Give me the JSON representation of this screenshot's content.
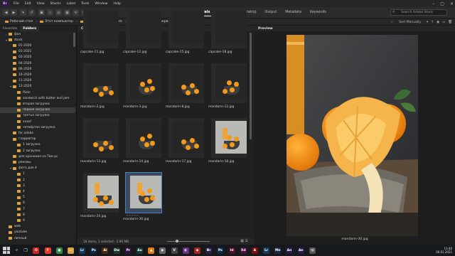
{
  "menubar": {
    "logo": "Br",
    "items": [
      "File",
      "Edit",
      "View",
      "Stacks",
      "Label",
      "Tools",
      "Window",
      "Help"
    ]
  },
  "workspaces": [
    "Essentials",
    "Libraries",
    "Filmstrip",
    "Output",
    "Metadata",
    "Keywords"
  ],
  "search": {
    "placeholder": "Search Adobe Stock"
  },
  "breadcrumb": [
    "Рабочий стол",
    "Этот компьютер",
    "архив (F:)",
    "stock",
    "12-2020",
    "первая загрузка"
  ],
  "sort": {
    "label": "Sort Manually"
  },
  "left_panel": {
    "tabs": [
      "Favorites",
      "Folders"
    ],
    "tree": [
      {
        "label": "фон",
        "depth": 1,
        "expanded": false
      },
      {
        "label": "stock",
        "depth": 1,
        "expanded": true
      },
      {
        "label": "01-2020",
        "depth": 2
      },
      {
        "label": "01-2021",
        "depth": 2
      },
      {
        "label": "02-2020",
        "depth": 2
      },
      {
        "label": "04-2020",
        "depth": 2
      },
      {
        "label": "06-2020",
        "depth": 2
      },
      {
        "label": "10-2020",
        "depth": 2
      },
      {
        "label": "11-2020",
        "depth": 2
      },
      {
        "label": "12-2020",
        "depth": 2,
        "expanded": true
      },
      {
        "label": "flickr",
        "depth": 3
      },
      {
        "label": "sandwich with butter and jam",
        "depth": 3
      },
      {
        "label": "вторая загрузка",
        "depth": 3
      },
      {
        "label": "первая загрузка",
        "depth": 3,
        "selected": true
      },
      {
        "label": "третья загрузка",
        "depth": 3
      },
      {
        "label": "xxxxf",
        "depth": 3
      },
      {
        "label": "четвёртая загрузка",
        "depth": 3
      },
      {
        "label": "for adobe",
        "depth": 2
      },
      {
        "label": "гладиатор",
        "depth": 2
      },
      {
        "label": "1 загрузка",
        "depth": 3
      },
      {
        "label": "2 загрузка",
        "depth": 3
      },
      {
        "label": "для хранения на Твм рс",
        "depth": 2
      },
      {
        "label": "рекомы",
        "depth": 2
      },
      {
        "label": "фото для 4",
        "depth": 2,
        "expanded": true
      },
      {
        "label": "1",
        "depth": 3
      },
      {
        "label": "2",
        "depth": 3
      },
      {
        "label": "3",
        "depth": 3
      },
      {
        "label": "4",
        "depth": 3
      },
      {
        "label": "5",
        "depth": 3
      },
      {
        "label": "6",
        "depth": 3
      },
      {
        "label": "7",
        "depth": 3
      },
      {
        "label": "8",
        "depth": 3
      },
      {
        "label": "9",
        "depth": 3
      },
      {
        "label": "web",
        "depth": 1
      },
      {
        "label": "youtube",
        "depth": 1
      },
      {
        "label": "личный",
        "depth": 1
      }
    ]
  },
  "content": {
    "title": "Content",
    "items": [
      {
        "name": "capcake-11.jpg",
        "style": "dark"
      },
      {
        "name": "capcake-12.jpg",
        "style": "dark"
      },
      {
        "name": "capcake-15.jpg",
        "style": "dark"
      },
      {
        "name": "capcake-18.jpg",
        "style": "dark"
      },
      {
        "name": "mandarin-2.jpg",
        "style": "bowl"
      },
      {
        "name": "mandarin-3.jpg",
        "style": "bowl"
      },
      {
        "name": "mandarin-8.jpg",
        "style": "bowl"
      },
      {
        "name": "mandarin-12.jpg",
        "style": "bowl"
      },
      {
        "name": "mandarin-13.jpg",
        "style": "bowl"
      },
      {
        "name": "mandarin-14.jpg",
        "style": "bowl"
      },
      {
        "name": "mandarin-17.jpg",
        "style": "bowl"
      },
      {
        "name": "mandarin-18.jpg",
        "style": "light"
      },
      {
        "name": "mandarin-24.jpg",
        "style": "light"
      },
      {
        "name": "mandarin-30.jpg",
        "style": "light",
        "selected": true,
        "stars": "☆☆☆☆☆"
      }
    ],
    "status": "18 items, 1 selected - 2.90 MB"
  },
  "preview": {
    "title": "Preview",
    "caption": "mandarin-30.jpg"
  },
  "taskbar": {
    "time": "13:40",
    "date": "06.01.2021",
    "icons": [
      {
        "name": "opera",
        "label": "O",
        "color": "#d3222a"
      },
      {
        "name": "yandex",
        "label": "Y",
        "color": "#e6382b"
      },
      {
        "name": "chrome",
        "label": "●",
        "color": "#2f8c46"
      },
      {
        "name": "explorer",
        "label": "▭",
        "color": "#d9a441"
      },
      {
        "name": "lightroom",
        "label": "Lr",
        "color": "#143a5c"
      },
      {
        "name": "photoshop",
        "label": "Ps",
        "color": "#0e2a47"
      },
      {
        "name": "illustrator",
        "label": "Ai",
        "color": "#4a2a0e"
      },
      {
        "name": "dreamweaver",
        "label": "Dw",
        "color": "#1e3a2a"
      },
      {
        "name": "premiere",
        "label": "Pr",
        "color": "#2a1440"
      },
      {
        "name": "audition",
        "label": "Au",
        "color": "#123a38"
      },
      {
        "name": "vlc",
        "label": "▲",
        "color": "#e27a12"
      },
      {
        "name": "media",
        "label": "▶",
        "color": "#6a6a6a"
      },
      {
        "name": "vegas",
        "label": "V",
        "color": "#444"
      },
      {
        "name": "app1",
        "label": "◐",
        "color": "#6b2f8a"
      },
      {
        "name": "app2",
        "label": "◆",
        "color": "#aa2222"
      },
      {
        "name": "bridge",
        "label": "Br",
        "color": "#2e1f4a"
      },
      {
        "name": "photoshop2",
        "label": "Ps",
        "color": "#0e2a47"
      },
      {
        "name": "indesign",
        "label": "Id",
        "color": "#4a0f2a"
      },
      {
        "name": "xd",
        "label": "Xd",
        "color": "#4a0f3a"
      },
      {
        "name": "acrobat",
        "label": "A",
        "color": "#7a1010"
      },
      {
        "name": "lr2",
        "label": "Lr",
        "color": "#143a5c"
      },
      {
        "name": "media2",
        "label": "Me",
        "color": "#1c2a4a"
      },
      {
        "name": "an",
        "label": "An",
        "color": "#2a1a4a"
      },
      {
        "name": "ae",
        "label": "Ae",
        "color": "#2a1a4a"
      },
      {
        "name": "file",
        "label": "▤",
        "color": "#555"
      }
    ]
  }
}
